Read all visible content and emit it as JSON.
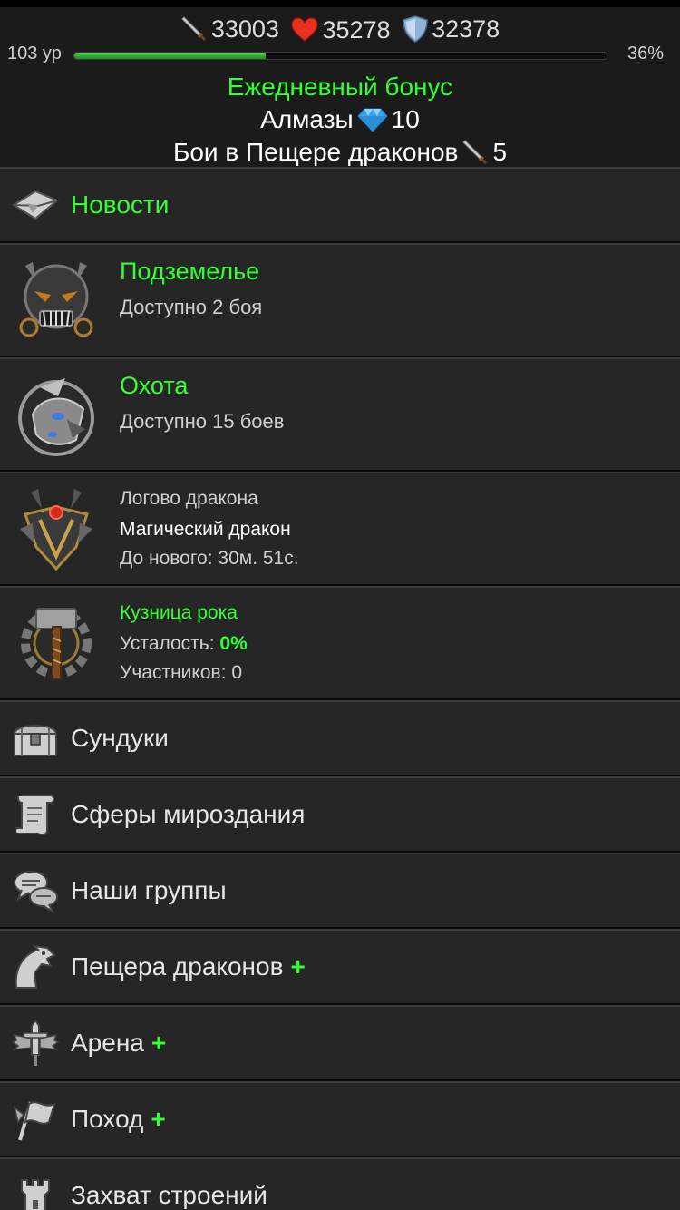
{
  "header": {
    "attack": "33003",
    "health": "35278",
    "defense": "32378",
    "level": "103 ур",
    "xp_percent": "36%",
    "xp_fraction": 0.36,
    "daily_bonus": "Ежедневный бонус",
    "diamonds_label": "Алмазы",
    "diamonds_value": "10",
    "cave_battles_label": "Бои в Пещере драконов",
    "cave_battles_value": "5"
  },
  "menu": {
    "news": "Новости",
    "dungeon": {
      "title": "Подземелье",
      "subtitle": "Доступно 2 боя"
    },
    "hunt": {
      "title": "Охота",
      "subtitle": "Доступно 15 боев"
    },
    "lair": {
      "title": "Логово дракона",
      "name": "Магический дракон",
      "timer": "До нового: 30м. 51с."
    },
    "forge": {
      "title": "Кузница рока",
      "fatigue_label": "Усталость:",
      "fatigue_value": "0%",
      "participants": "Участников: 0"
    },
    "chests": "Сундуки",
    "spheres": "Сферы мироздания",
    "groups": "Наши группы",
    "cave": "Пещера драконов",
    "arena": "Арена",
    "campaign": "Поход",
    "capture": "Захват строений",
    "plus": "+"
  },
  "colors": {
    "accent_green": "#33ff33",
    "background": "#262626",
    "header_bg": "#1b1b1b"
  },
  "icons": [
    "sword-icon",
    "heart-icon",
    "shield-icon",
    "diamond-icon",
    "envelope-icon",
    "skull-mask-icon",
    "wolf-helm-icon",
    "dragon-crest-icon",
    "hammer-gear-icon",
    "chest-icon",
    "scroll-icon",
    "chat-icon",
    "dragon-head-icon",
    "winged-sword-icon",
    "flag-icon",
    "tower-icon"
  ]
}
